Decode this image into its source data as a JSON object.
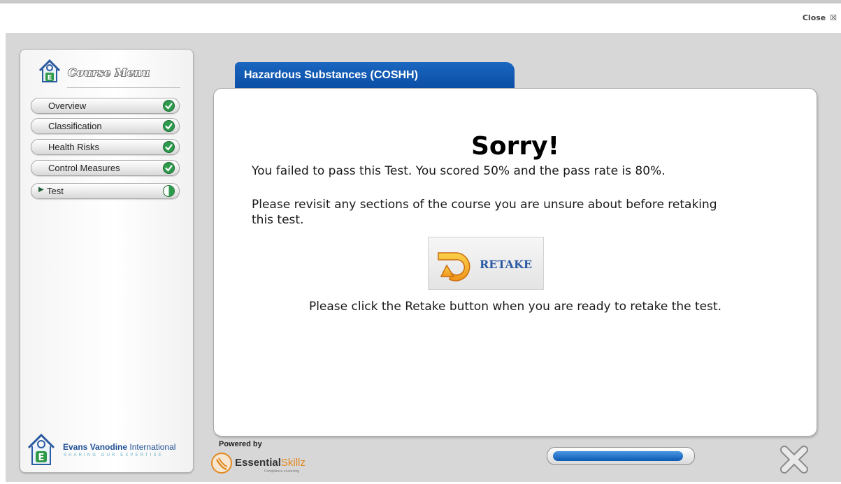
{
  "window": {
    "close_label": "Close",
    "close_glyph": "☒"
  },
  "sidebar": {
    "menu_title": "Course Menu",
    "items": [
      {
        "label": "Overview",
        "status": "complete",
        "current": false
      },
      {
        "label": "Classification",
        "status": "complete",
        "current": false
      },
      {
        "label": "Health Risks",
        "status": "complete",
        "current": false
      },
      {
        "label": "Control Measures",
        "status": "complete",
        "current": false
      },
      {
        "label": "Test",
        "status": "in-progress",
        "current": true
      }
    ],
    "brand": {
      "name_bold": "Evans Vanodine",
      "name_light": "International",
      "tagline": "SHARING OUR EXPERTISE"
    }
  },
  "course": {
    "title": "Hazardous Substances (COSHH)"
  },
  "result": {
    "heading": "Sorry!",
    "score_message": "You failed to pass this Test. You scored 50% and the pass rate is 80%.",
    "advice": "Please revisit any sections of the course you are unsure about before retaking this test.",
    "retake_label": "RETAKE",
    "instruction": "Please click the Retake button when you are ready to retake the test."
  },
  "footer": {
    "powered_by": "Powered by",
    "provider_a": "Essential",
    "provider_b": "Skillz",
    "provider_sub": "Compliance eLearning",
    "progress": 0.96
  },
  "colors": {
    "accent": "#0b4ea5",
    "check_green": "#2e9a4d",
    "progress_blue": "#0b59b4"
  },
  "icons": {
    "complete": "check-circle-icon",
    "in_progress": "half-circle-icon",
    "retake": "retake-arrow-icon",
    "exit": "close-x-icon"
  }
}
